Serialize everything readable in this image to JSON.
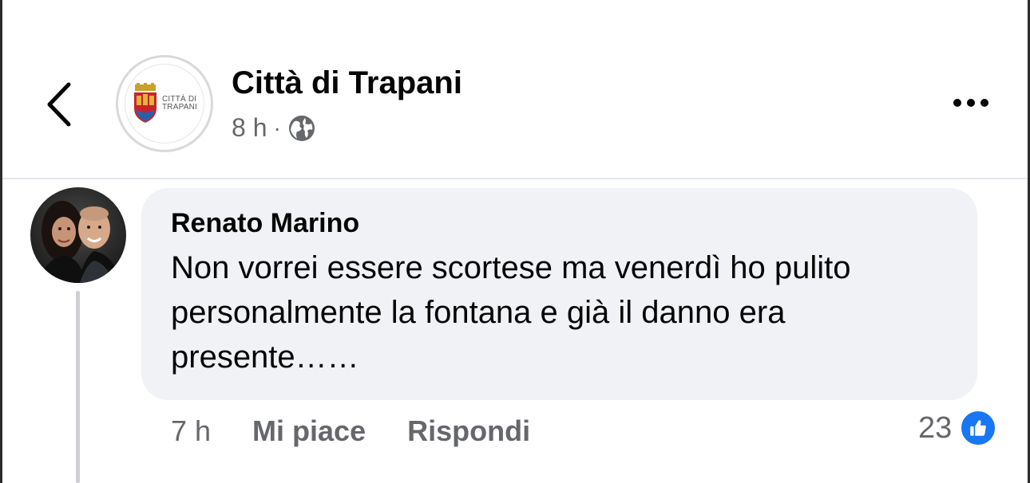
{
  "header": {
    "page_name": "Città di Trapani",
    "post_time": "8 h",
    "separator": "·",
    "privacy_icon": "globe-icon",
    "back_icon": "chevron-left-icon",
    "more_icon": "more-horizontal-icon",
    "logo_text_line1": "CITTÀ DI",
    "logo_text_line2": "TRAPANI"
  },
  "comment": {
    "author": "Renato Marino",
    "text": "Non vorrei essere scortese ma venerdì ho pulito personalmente la fontana e già il danno era presente……",
    "time": "7 h",
    "like_label": "Mi piace",
    "reply_label": "Rispondi",
    "reaction_count": "23",
    "reaction_icon": "thumbs-up-icon"
  },
  "colors": {
    "accent": "#1877f2",
    "bubble": "#f0f2f5",
    "secondary_text": "#65676b"
  }
}
